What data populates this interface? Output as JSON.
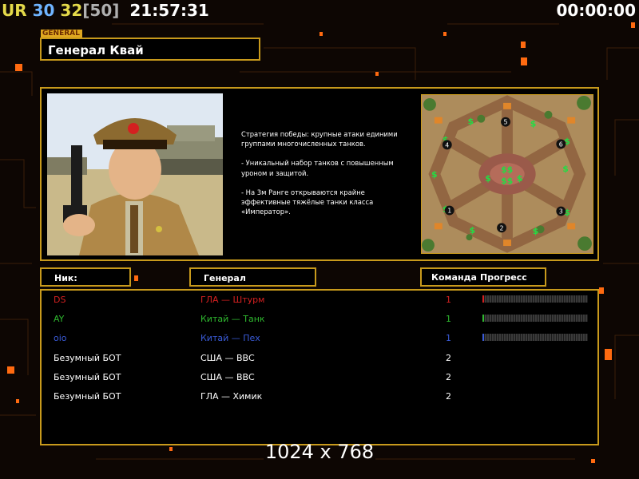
{
  "topbar": {
    "ur": "UR",
    "count_a": "30",
    "count_b": "32",
    "max": "[50]",
    "clock": "21:57:31",
    "timer": "00:00:00"
  },
  "general": {
    "tag": "GENERAL",
    "name": "Генерал Квай",
    "description": [
      "Стратегия победы: крупные атаки единими группами многочисленных танков.",
      "- Уникальный набор танков с повышенным уроном и защитой.",
      "- На 3м Ранге открываются крайне эффективные тяжёлые танки класса «Император»."
    ]
  },
  "map": {
    "spawn_labels": [
      "1",
      "2",
      "3",
      "4",
      "5",
      "6"
    ]
  },
  "table": {
    "headers": {
      "nick": "Ник:",
      "general": "Генерал",
      "team": "Команда",
      "progress": "Прогресс"
    },
    "rows": [
      {
        "nick": "DS",
        "general": "ГЛА — Штурм",
        "team": "1",
        "color": "#d42020",
        "progress": 0.01
      },
      {
        "nick": "AY",
        "general": "Китай — Танк",
        "team": "1",
        "color": "#2fb82f",
        "progress": 0.01
      },
      {
        "nick": "oio",
        "general": "Китай — Пех",
        "team": "1",
        "color": "#3a5bd8",
        "progress": 0.0
      },
      {
        "nick": "Безумный БОТ",
        "general": "США — ВВС",
        "team": "2",
        "color": "#ffffff",
        "progress": null
      },
      {
        "nick": "Безумный БОТ",
        "general": "США — ВВС",
        "team": "2",
        "color": "#ffffff",
        "progress": null
      },
      {
        "nick": "Безумный БОТ",
        "general": "ГЛА — Химик",
        "team": "2",
        "color": "#ffffff",
        "progress": null
      }
    ]
  },
  "resolution": "1024 x 768",
  "colors": {
    "accent": "#c89a1c",
    "background": "#0d0603"
  }
}
